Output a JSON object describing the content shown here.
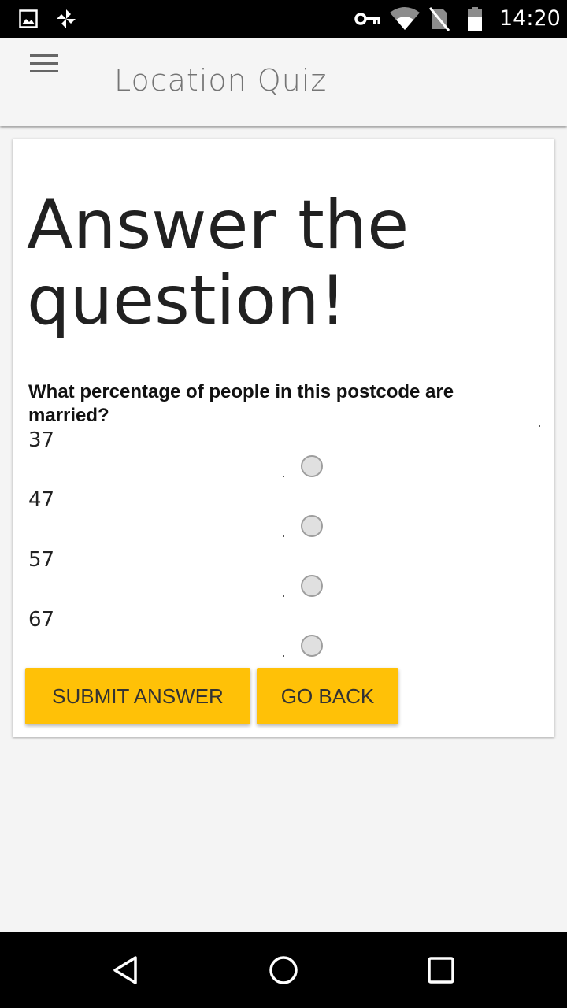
{
  "status_bar": {
    "time": "14:20",
    "icons": [
      "image-icon",
      "pinwheel-icon",
      "key-icon",
      "wifi-icon",
      "no-sim-icon",
      "battery-icon"
    ]
  },
  "app_bar": {
    "title": "Location Quiz",
    "menu_icon": "hamburger-menu-icon"
  },
  "quiz": {
    "heading": "Answer the question!",
    "question": "What percentage of people in this postcode are married?",
    "options": [
      "37",
      "47",
      "57",
      "67"
    ]
  },
  "buttons": {
    "submit_label": "SUBMIT ANSWER",
    "back_label": "GO BACK"
  },
  "nav_bar": {
    "icons": [
      "back-triangle-icon",
      "home-circle-icon",
      "recents-square-icon"
    ]
  },
  "colors": {
    "accent": "#ffc107",
    "app_bar_bg": "#f5f5f5",
    "page_bg": "#f4f4f4",
    "status_bar_bg": "#000000"
  }
}
